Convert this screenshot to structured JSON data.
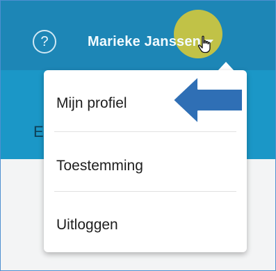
{
  "header": {
    "help_icon": "question-circle-icon",
    "help_glyph": "?",
    "user_name": "Marieke Janssen",
    "caret_icon": "caret-down-icon"
  },
  "subbar": {
    "partial_text": "E"
  },
  "dropdown": {
    "items": [
      {
        "label": "Mijn profiel"
      },
      {
        "label": "Toestemming"
      },
      {
        "label": "Uitloggen"
      }
    ]
  },
  "annotations": {
    "click_highlight_color": "#f0d428",
    "arrow_color": "#2f6fb5",
    "cursor_icon": "hand-pointer-icon",
    "arrow_icon": "left-arrow-icon"
  },
  "colors": {
    "header_bg": "#1d86b6",
    "subbar_bg": "#1b97c7"
  }
}
